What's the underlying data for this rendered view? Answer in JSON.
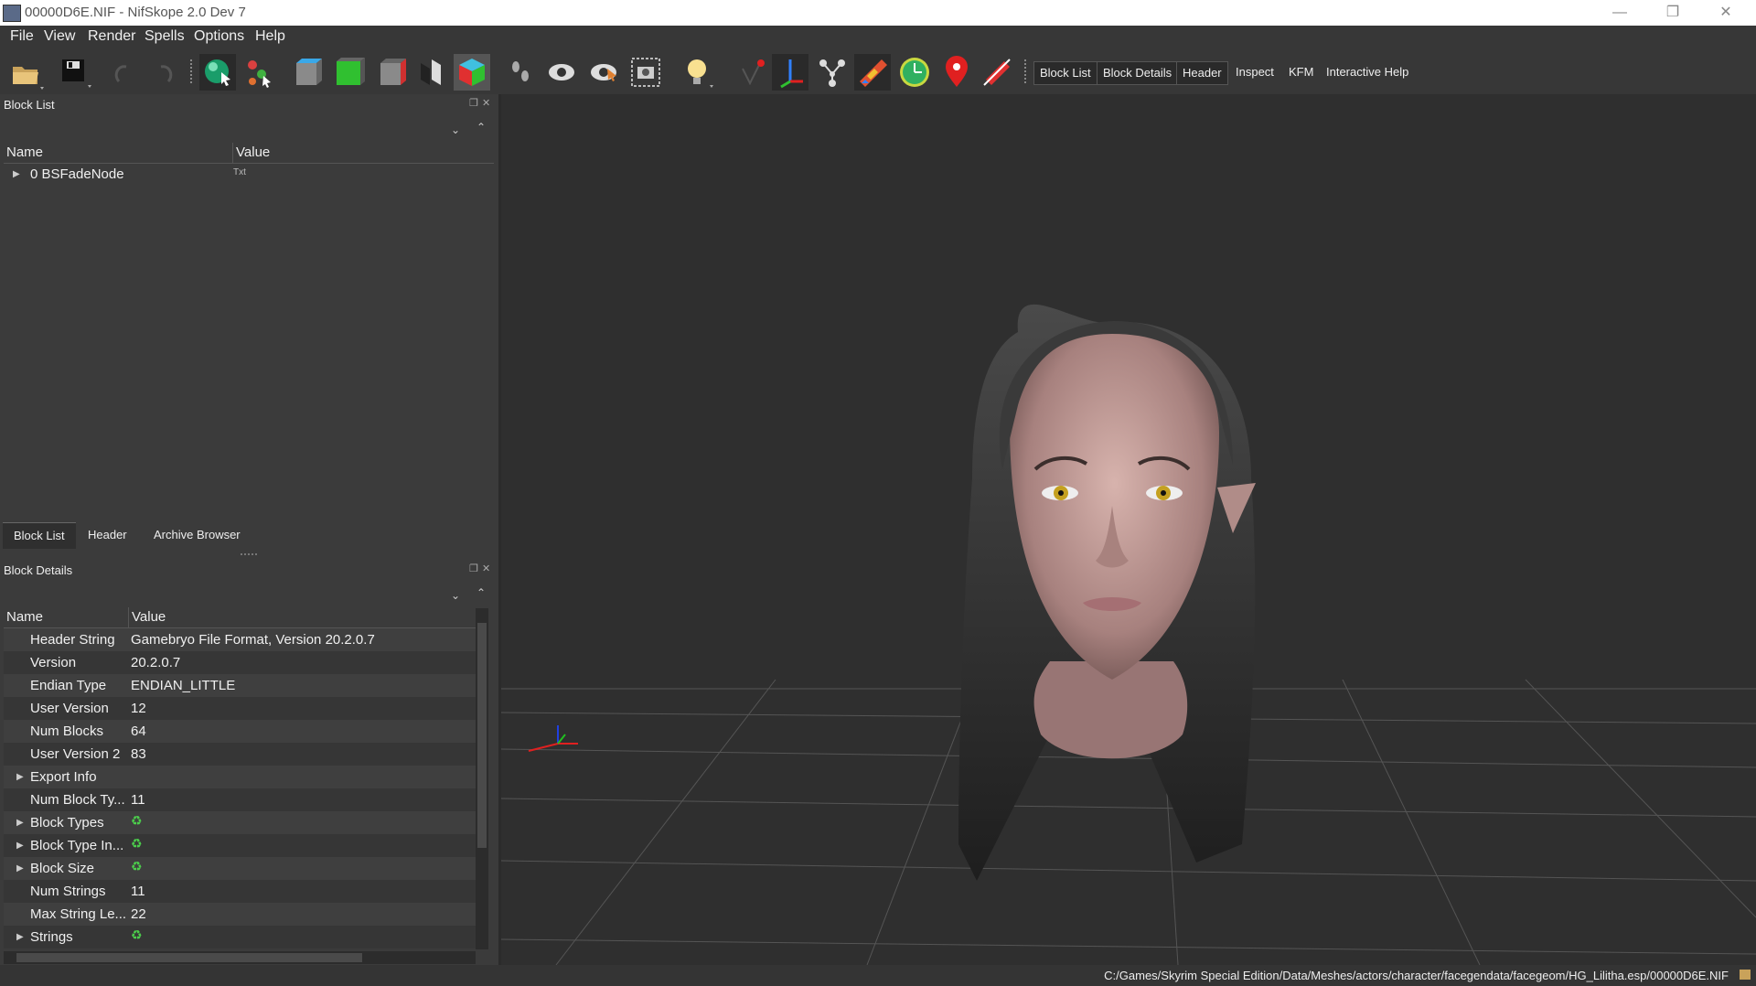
{
  "window": {
    "title": "00000D6E.NIF - NifSkope 2.0 Dev 7",
    "controls": {
      "minimize": "—",
      "maximize": "❐",
      "close": "✕"
    }
  },
  "menu": [
    "File",
    "View",
    "Render",
    "Spells",
    "Options",
    "Help"
  ],
  "toolbar": {
    "icons": [
      "open-icon",
      "save-icon",
      "undo-icon",
      "redo-icon",
      "select-icon",
      "skeleton-icon",
      "box-blue-icon",
      "box-green-icon",
      "box-red-icon",
      "split-icon",
      "cube-icon",
      "footprints-icon",
      "eye-icon",
      "eye-hidden-icon",
      "camera-icon",
      "lightbulb-icon",
      "vertex-icon",
      "axes-icon",
      "nodes-icon",
      "gradient-icon",
      "clock-icon",
      "marker-icon",
      "pin-off-icon"
    ],
    "text_buttons": [
      "Block List",
      "Block Details",
      "Header",
      "Inspect",
      "KFM",
      "Interactive Help"
    ]
  },
  "block_list": {
    "title": "Block List",
    "columns": [
      "Name",
      "Value"
    ],
    "rows": [
      {
        "name": "0 BSFadeNode",
        "value": "Txt"
      }
    ]
  },
  "left_tabs": [
    "Block List",
    "Header",
    "Archive Browser"
  ],
  "block_details": {
    "title": "Block Details",
    "columns": [
      "Name",
      "Value"
    ],
    "rows": [
      {
        "name": "Header String",
        "value": "Gamebryo File Format, Version 20.2.0.7",
        "expandable": false
      },
      {
        "name": "Version",
        "value": "20.2.0.7",
        "expandable": false
      },
      {
        "name": "Endian Type",
        "value": "ENDIAN_LITTLE",
        "expandable": false
      },
      {
        "name": "User Version",
        "value": "12",
        "expandable": false
      },
      {
        "name": "Num Blocks",
        "value": "64",
        "expandable": false
      },
      {
        "name": "User Version 2",
        "value": "83",
        "expandable": false
      },
      {
        "name": "Export Info",
        "value": "",
        "expandable": true
      },
      {
        "name": "Num Block Ty...",
        "value": "11",
        "expandable": false
      },
      {
        "name": "Block Types",
        "value": "",
        "expandable": true,
        "refresh": true
      },
      {
        "name": "Block Type In...",
        "value": "",
        "expandable": true,
        "refresh": true
      },
      {
        "name": "Block Size",
        "value": "",
        "expandable": true,
        "refresh": true
      },
      {
        "name": "Num Strings",
        "value": "11",
        "expandable": false
      },
      {
        "name": "Max String Le...",
        "value": "22",
        "expandable": false
      },
      {
        "name": "Strings",
        "value": "",
        "expandable": true,
        "refresh": true
      }
    ]
  },
  "status": {
    "path": "C:/Games/Skyrim Special Edition/Data/Meshes/actors/character/facegendata/facegeom/HG_Lilitha.esp/00000D6E.NIF"
  },
  "colors": {
    "panel": "#3b3b3b",
    "viewport": "#2f2f2f",
    "accent_green": "#4cd04c",
    "axis_x": "#e02020",
    "axis_y": "#20c020",
    "axis_z": "#2040e0"
  }
}
